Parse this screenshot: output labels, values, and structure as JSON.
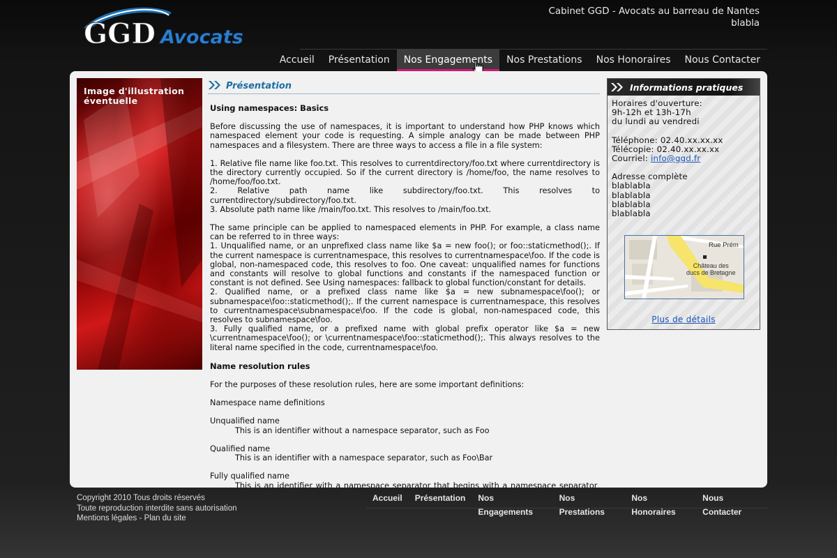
{
  "brand": {
    "logo_main": "GGD",
    "logo_sub": "Avocats"
  },
  "tagline": {
    "line1": "Cabinet GGD - Avocats au barreau de Nantes",
    "line2": "blabla"
  },
  "nav": {
    "active": "Nos Engagements",
    "items": [
      {
        "label": "Accueil"
      },
      {
        "label": "Présentation"
      },
      {
        "label": "Nos Engagements"
      },
      {
        "label": "Nos Prestations"
      },
      {
        "label": "Nos Honoraires"
      },
      {
        "label": "Nous Contacter"
      }
    ]
  },
  "illustration": {
    "line1": "Image d'illustration",
    "line2": "éventuelle"
  },
  "section": {
    "title": "Présentation"
  },
  "article": {
    "h1": "Using namespaces: Basics",
    "p1": "Before discussing the use of namespaces, it is important to understand how PHP knows which namespaced element your code is requesting. A simple analogy can be made between PHP namespaces and a filesystem. There are three ways to access a file in a file system:",
    "l1": "1. Relative file name like foo.txt. This resolves to currentdirectory/foo.txt where currentdirectory is the directory currently occupied. So if the current directory is /home/foo, the name resolves to /home/foo/foo.txt.",
    "l2": "2. Relative path name like subdirectory/foo.txt. This resolves to currentdirectory/subdirectory/foo.txt.",
    "l3": "3. Absolute path name like /main/foo.txt. This resolves to /main/foo.txt.",
    "p2": "The same principle can be applied to namespaced elements in PHP. For example, a class name can be referred to in three ways:",
    "m1": "1. Unqualified name, or an unprefixed class name like $a = new foo(); or foo::staticmethod();. If the current namespace is currentnamespace, this resolves to currentnamespace\\foo. If the code is global, non-namespaced code, this resolves to foo. One caveat: unqualified names for functions and constants will resolve to global functions and constants if the namespaced function or constant is not defined. See Using namespaces: fallback to global function/constant for details.",
    "m2": "2. Qualified name, or a prefixed class name like $a = new subnamespace\\foo(); or subnamespace\\foo::staticmethod();. If the current namespace is currentnamespace, this resolves to currentnamespace\\subnamespace\\foo. If the code is global, non-namespaced code, this resolves to subnamespace\\foo.",
    "m3": "3. Fully qualified name, or a prefixed name with global prefix operator like $a = new \\currentnamespace\\foo(); or \\currentnamespace\\foo::staticmethod();. This always resolves to the literal name specified in the code, currentnamespace\\foo.",
    "h2": "Name resolution rules",
    "p3": "For the purposes of these resolution rules, here are some important definitions:",
    "p4": "Namespace name definitions",
    "d1t": "Unqualified name",
    "d1d": "This is an identifier without a namespace separator, such as Foo",
    "d2t": "Qualified name",
    "d2d": "This is an identifier with a namespace separator, such as Foo\\Bar",
    "d3t": "Fully qualified name",
    "d3d": "This is an identifier with a namespace separator that begins with a namespace separator, such"
  },
  "sidebar": {
    "title": "Informations pratiques",
    "hours_label": "Horaires d'ouverture:",
    "hours": "9h-12h et 13h-17h",
    "days": "du lundi au vendredi",
    "phone": "Téléphone: 02.40.xx.xx.xx",
    "fax": "Télécopie: 02.40.xx.xx.xx",
    "email_label": "Courriel:",
    "email": "info@ggd.fr",
    "address_label": "Adresse complète",
    "address": [
      "blablabla",
      "blablabla",
      "blablabla",
      "blablabla"
    ],
    "map_label_street": "Rue Prém",
    "map_label_place1": "Château des",
    "map_label_place2": "ducs de Bretagne",
    "details_link": "Plus de détails"
  },
  "footer": {
    "copyright": "Copyright 2010 Tous droits réservés",
    "notice": "Toute reproduction interdite sans autorisation",
    "legal": "Mentions légales",
    "separator": "-",
    "sitemap": "Plan du site",
    "nav": [
      "Accueil",
      "Présentation",
      "Nos Engagements",
      "Nos Prestations",
      "Nos Honoraires",
      "Nous Contacter"
    ]
  },
  "colors": {
    "accent_pink": "#d4147a",
    "link_blue": "#1a55b8",
    "title_blue": "#1b6fa6"
  }
}
